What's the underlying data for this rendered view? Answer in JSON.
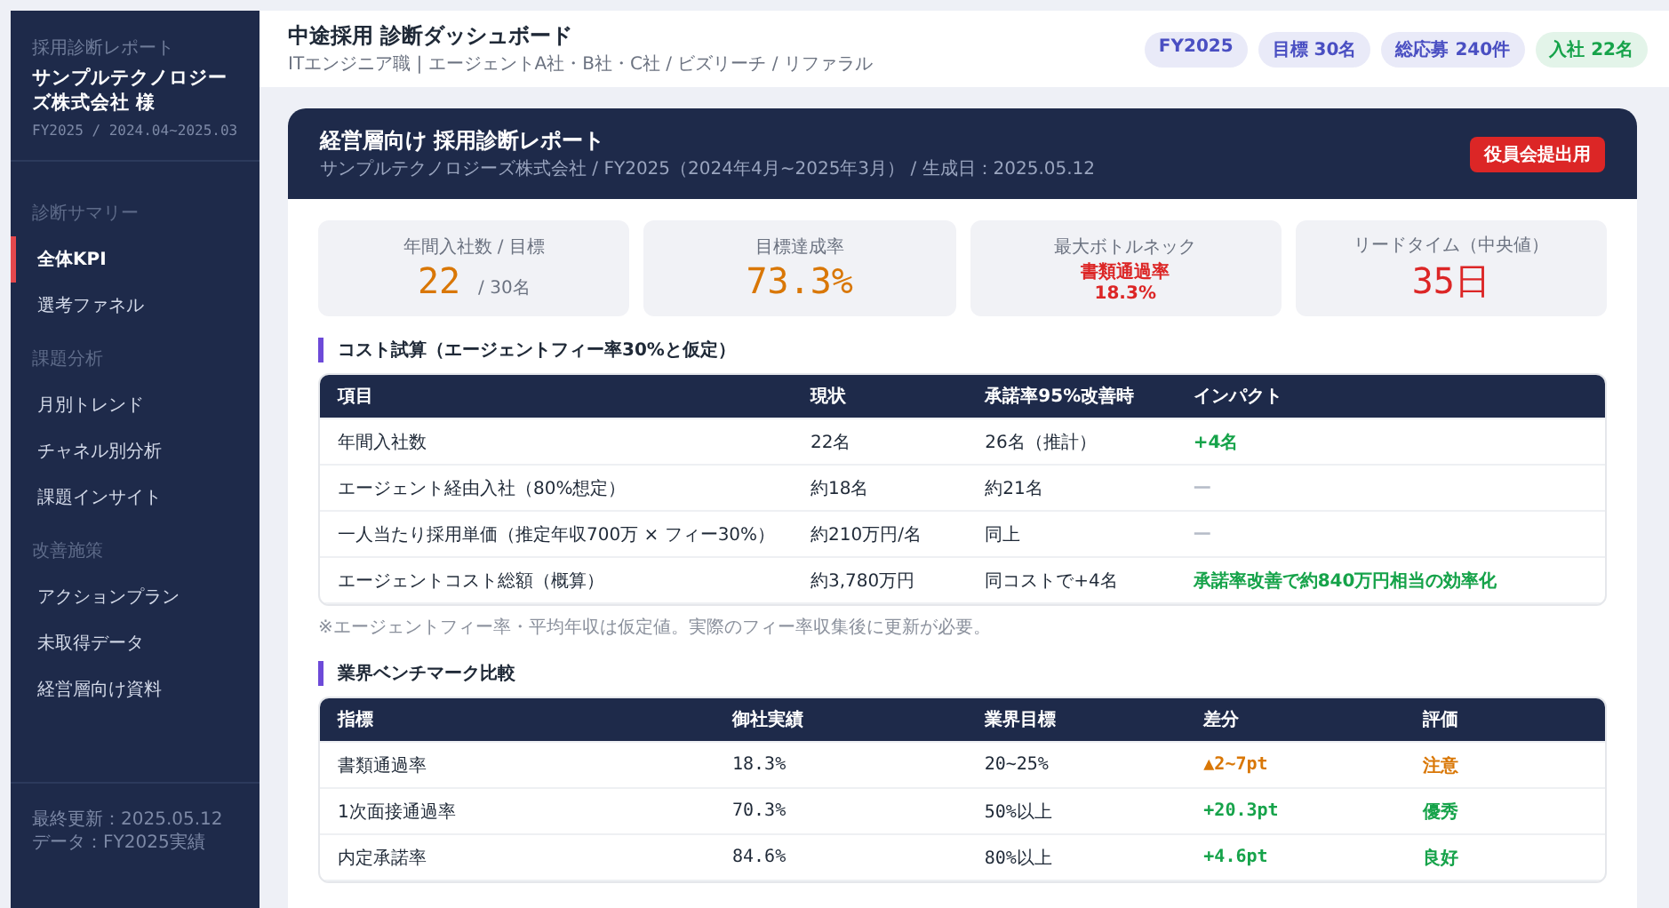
{
  "sidebar": {
    "eyebrow": "採用診断レポート",
    "client": "サンプルテクノロジーズ株式会社 様",
    "period": "FY2025 / 2024.04~2025.03",
    "sections": [
      {
        "label": "診断サマリー",
        "items": [
          {
            "label": "全体KPI",
            "selected": true
          },
          {
            "label": "選考ファネル",
            "selected": false
          }
        ]
      },
      {
        "label": "課題分析",
        "items": [
          {
            "label": "月別トレンド",
            "selected": false
          },
          {
            "label": "チャネル別分析",
            "selected": false
          },
          {
            "label": "課題インサイト",
            "selected": false
          }
        ]
      },
      {
        "label": "改善施策",
        "items": [
          {
            "label": "アクションプラン",
            "selected": false
          },
          {
            "label": "未取得データ",
            "selected": false
          },
          {
            "label": "経営層向け資料",
            "selected": false
          }
        ]
      }
    ],
    "footer": [
      "最終更新：2025.05.12",
      "データ：FY2025実績"
    ]
  },
  "header": {
    "title": "中途採用 診断ダッシュボード",
    "subtitle": "ITエンジニア職 | エージェントA社・B社・C社 / ビズリーチ / リファラル",
    "badges": [
      {
        "label": "FY2025",
        "color": "#4a4fc2"
      },
      {
        "label": "目標 30名",
        "color": "#4a4fc2"
      },
      {
        "label": "総応募 240件",
        "color": "#4a4fc2"
      },
      {
        "label": "入社 22名",
        "color": "#16a34a"
      }
    ]
  },
  "report": {
    "title": "経営層向け 採用診断レポート",
    "meta": "サンプルテクノロジーズ株式会社 / FY2025（2024年4月~2025年3月） / 生成日：2025.05.12",
    "tag": "役員会提出用",
    "kpis": [
      {
        "label": "年間入社数 / 目標",
        "value": "22",
        "suffix": "/ 30名",
        "color": "#d97706"
      },
      {
        "label": "目標達成率",
        "value": "73.3%",
        "color": "#d97706"
      },
      {
        "label": "最大ボトルネック",
        "value": "書類通過率",
        "sub": "18.3%",
        "color": "#dc2626",
        "kind": "small"
      },
      {
        "label": "リードタイム（中央値）",
        "value": "35日",
        "color": "#dc2626"
      }
    ],
    "cost": {
      "title": "コスト試算（エージェントフィー率30%と仮定）",
      "columns": [
        "項目",
        "現状",
        "承諾率95%改善時",
        "インパクト"
      ],
      "rows": [
        {
          "cells": [
            "年間入社数",
            "22名",
            "26名（推計）",
            "+4名"
          ],
          "color": "#16a34a"
        },
        {
          "cells": [
            "エージェント経由入社（80%想定）",
            "約18名",
            "約21名",
            "—"
          ],
          "color": "#b6bcc8"
        },
        {
          "cells": [
            "一人当たり採用単価（推定年収700万 × フィー30%）",
            "約210万円/名",
            "同上",
            "—"
          ],
          "color": "#b6bcc8"
        },
        {
          "cells": [
            "エージェントコスト総額（概算）",
            "約3,780万円",
            "同コストで+4名",
            "承諾率改善で約840万円相当の効率化"
          ],
          "color": "#16a34a"
        }
      ],
      "note": "※エージェントフィー率・平均年収は仮定値。実際のフィー率収集後に更新が必要。"
    },
    "bench": {
      "title": "業界ベンチマーク比較",
      "columns": [
        "指標",
        "御社実績",
        "業界目標",
        "差分",
        "評価"
      ],
      "rows": [
        {
          "cells": [
            "書類通過率",
            "18.3%",
            "20~25%",
            "▲2~7pt",
            "注意"
          ],
          "color": "#d97706"
        },
        {
          "cells": [
            "1次面接通過率",
            "70.3%",
            "50%以上",
            "+20.3pt",
            "優秀"
          ],
          "color": "#16a34a"
        },
        {
          "cells": [
            "内定承諾率",
            "84.6%",
            "80%以上",
            "+4.6pt",
            "良好"
          ],
          "color": "#16a34a"
        }
      ]
    }
  }
}
